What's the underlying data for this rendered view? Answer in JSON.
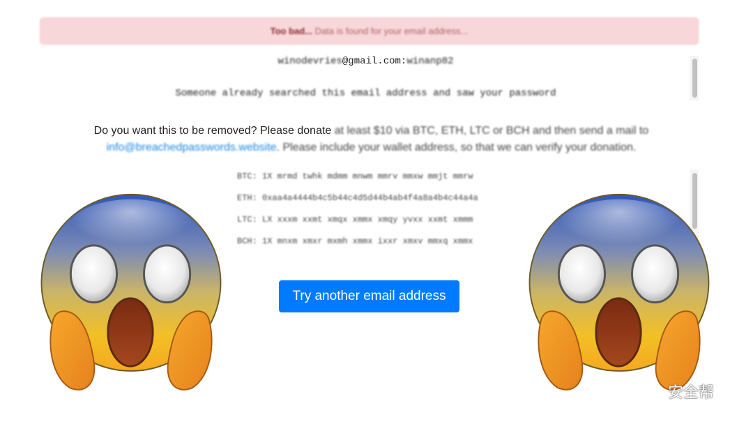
{
  "alert": {
    "strong": "Too bad...",
    "text": " Data is found for your email address..."
  },
  "result": {
    "credential_visible": "@gmail.com:",
    "credential_user_blurred": "winodevries",
    "credential_pass_blurred": "winanp82",
    "note": "Someone already searched this email address and saw your password"
  },
  "donate": {
    "clear_text": "Do you want this to be removed? Please donate",
    "blurred_text": " at least $10 via BTC, ETH, LTC or BCH and then send a mail to ",
    "email_link": "info@breachedpasswords.website",
    "tail_text": ". Please include your wallet address, so that we can verify your donation."
  },
  "wallets": [
    {
      "label": "BTC:",
      "address": "1X mrmd twhk mdmm mnwm mmrv mmxw mmjt mmrw"
    },
    {
      "label": "ETH:",
      "address": "0xaa4a4444b4c5b44c4d5d44b4ab4f4a8a4b4c44a4a"
    },
    {
      "label": "LTC:",
      "address": "LX xxxm xxmt xmqx xmmx xmqy yvxx xxmt xmmm"
    },
    {
      "label": "BCH:",
      "address": "1X mnxm xmxr mxmh xmmx ixxr xmxv mmxq xmmx"
    }
  ],
  "button": {
    "label": "Try another email address"
  },
  "emoji": {
    "name": "face-screaming-in-fear"
  },
  "colors": {
    "button": "#007bff",
    "alert_bg": "#f8d7da",
    "link": "#1e88e5"
  },
  "watermark": {
    "text": "安全帮"
  }
}
